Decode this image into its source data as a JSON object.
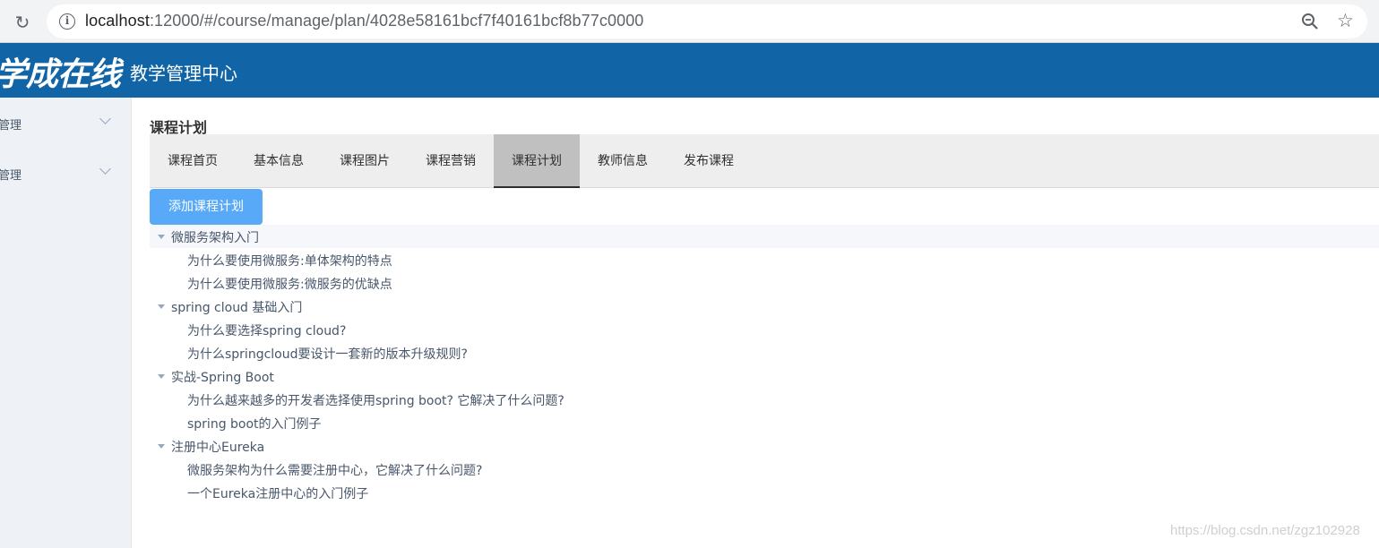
{
  "browser": {
    "url_host": "localhost",
    "url_rest": ":12000/#/course/manage/plan/4028e58161bcf7f40161bcf8b77c0000"
  },
  "header": {
    "logo": "学成在线",
    "title": "教学管理中心",
    "bg_color": "#1165a6"
  },
  "sidebar": {
    "items": [
      {
        "label": "管理"
      },
      {
        "label": "管理"
      }
    ]
  },
  "main": {
    "page_title": "课程计划",
    "tabs": [
      {
        "label": "课程首页"
      },
      {
        "label": "基本信息"
      },
      {
        "label": "课程图片"
      },
      {
        "label": "课程营销"
      },
      {
        "label": "课程计划",
        "active": true
      },
      {
        "label": "教师信息"
      },
      {
        "label": "发布课程"
      }
    ],
    "add_button": "添加课程计划",
    "tree": [
      {
        "label": "微服务架构入门",
        "children": [
          "为什么要使用微服务:单体架构的特点",
          "为什么要使用微服务:微服务的优缺点"
        ]
      },
      {
        "label": "spring cloud 基础入门",
        "children": [
          "为什么要选择spring cloud?",
          "为什么springcloud要设计一套新的版本升级规则?"
        ]
      },
      {
        "label": "实战-Spring Boot",
        "children": [
          "为什么越来越多的开发者选择使用spring boot?  它解决了什么问题?",
          "spring boot的入门例子"
        ]
      },
      {
        "label": "注册中心Eureka",
        "children": [
          "微服务架构为什么需要注册中心，它解决了什么问题?",
          "一个Eureka注册中心的入门例子"
        ]
      }
    ]
  },
  "watermark": "https://blog.csdn.net/zgz102928"
}
